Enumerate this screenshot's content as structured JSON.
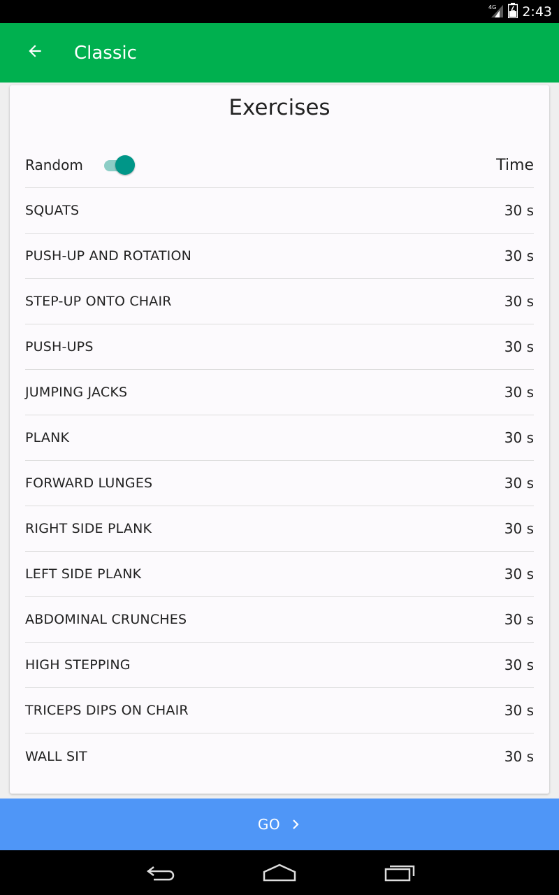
{
  "status": {
    "time": "2:43",
    "network": "4G"
  },
  "appbar": {
    "title": "Classic"
  },
  "card": {
    "title": "Exercises",
    "random_label": "Random",
    "random_on": true,
    "time_header": "Time"
  },
  "exercises": [
    {
      "name": "SQUATS",
      "time": "30 s"
    },
    {
      "name": "PUSH-UP AND ROTATION",
      "time": "30 s"
    },
    {
      "name": "STEP-UP ONTO CHAIR",
      "time": "30 s"
    },
    {
      "name": "PUSH-UPS",
      "time": "30 s"
    },
    {
      "name": "JUMPING JACKS",
      "time": "30 s"
    },
    {
      "name": "PLANK",
      "time": "30 s"
    },
    {
      "name": "FORWARD LUNGES",
      "time": "30 s"
    },
    {
      "name": "RIGHT SIDE PLANK",
      "time": "30 s"
    },
    {
      "name": "LEFT SIDE PLANK",
      "time": "30 s"
    },
    {
      "name": "ABDOMINAL CRUNCHES",
      "time": "30 s"
    },
    {
      "name": "HIGH STEPPING",
      "time": "30 s"
    },
    {
      "name": "TRICEPS DIPS ON CHAIR",
      "time": "30 s"
    },
    {
      "name": "WALL SIT",
      "time": "30 s"
    }
  ],
  "go_button": {
    "label": "GO"
  },
  "colors": {
    "appbar": "#00b04f",
    "go_bar": "#4f96f7",
    "switch_accent": "#009688"
  },
  "icons": {
    "back": "arrow-left-icon",
    "go": "chevron-right-icon",
    "nav_back": "back-nav-icon",
    "nav_home": "home-nav-icon",
    "nav_recents": "recents-nav-icon"
  }
}
